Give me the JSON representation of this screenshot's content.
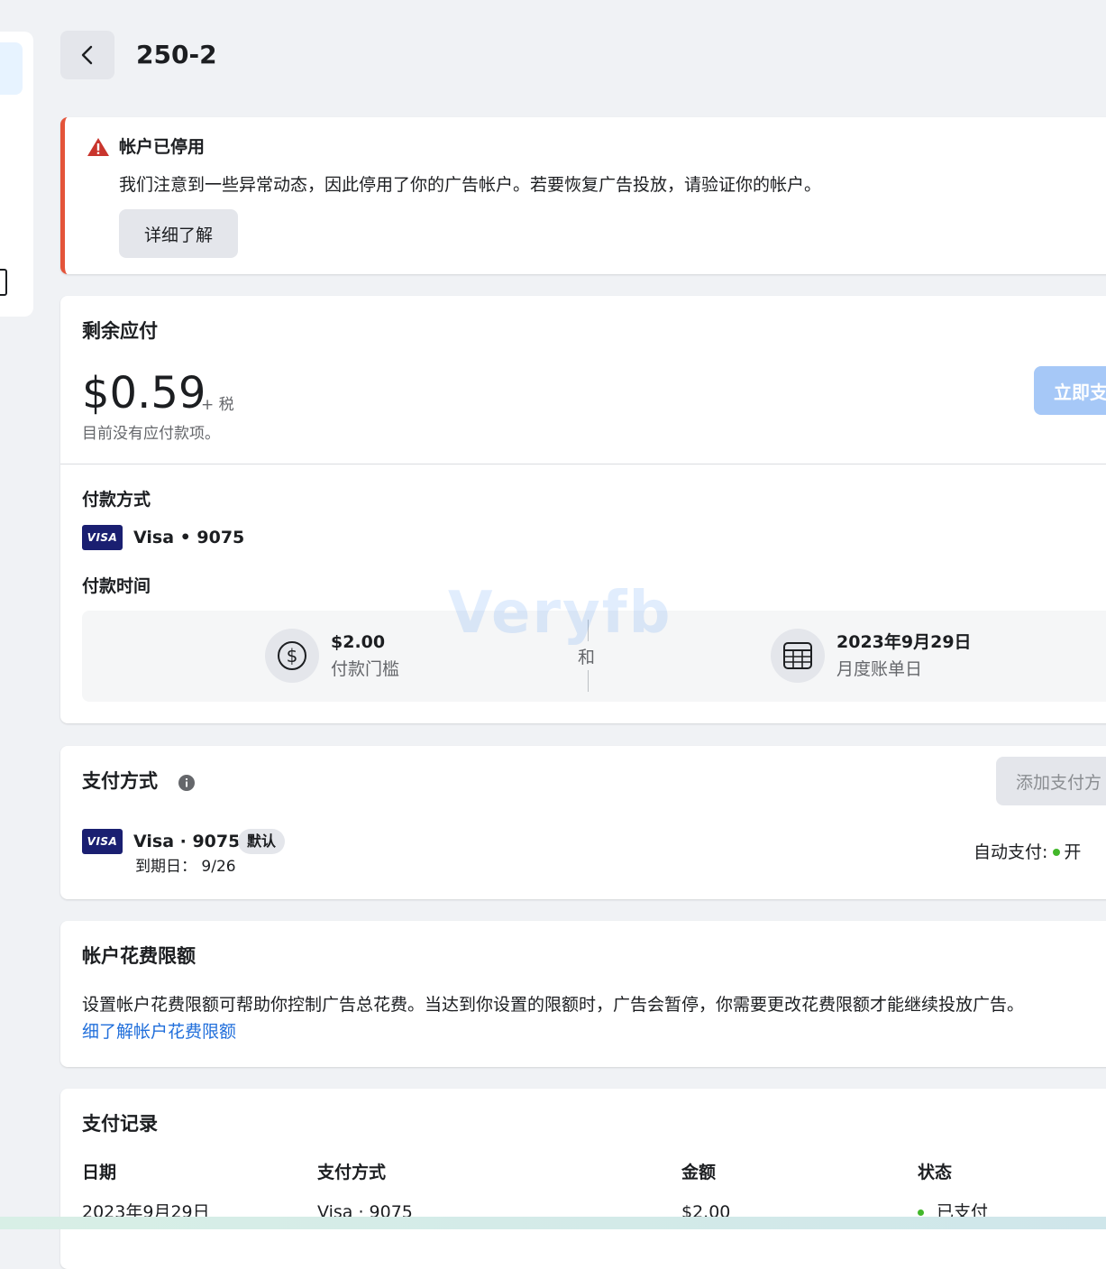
{
  "header": {
    "title": "250-2"
  },
  "alert": {
    "title": "帐户已停用",
    "message": "我们注意到一些异常动态，因此停用了你的广告帐户。若要恢复广告投放，请验证你的帐户。",
    "learn_more": "详细了解",
    "accent_color": "#e4543a"
  },
  "balance": {
    "title": "剩余应付",
    "amount": "$0.59",
    "tax": "+ 税",
    "no_due": "目前没有应付款项。",
    "pay_now": "立即支",
    "payment_method_title": "付款方式",
    "card_brand_badge": "VISA",
    "card_label": "Visa • 9075",
    "payment_time_title": "付款时间",
    "threshold_value": "$2.00",
    "threshold_label": "付款门槛",
    "and_text": "和",
    "bill_date": "2023年9月29日",
    "bill_label": "月度账单日",
    "watermark": "Veryfb"
  },
  "methods": {
    "title": "支付方式",
    "add_button": "添加支付方",
    "card_brand_badge": "VISA",
    "card_label": "Visa · 9075",
    "default_badge": "默认",
    "expiry": "到期日：  9/26",
    "autopay_label": "自动支付:",
    "autopay_status": "开"
  },
  "limit": {
    "title": "帐户花费限额",
    "description": "设置帐户花费限额可帮助你控制广告总花费。当达到你设置的限额时，广告会暂停，你需要更改花费限额才能继续投放广告。",
    "link": "细了解帐户花费限额"
  },
  "history": {
    "title": "支付记录",
    "columns": [
      "日期",
      "支付方式",
      "金额",
      "状态"
    ],
    "rows": [
      [
        "2023年9月29日",
        "Visa · 9075",
        "$2.00",
        "已支付"
      ]
    ]
  }
}
